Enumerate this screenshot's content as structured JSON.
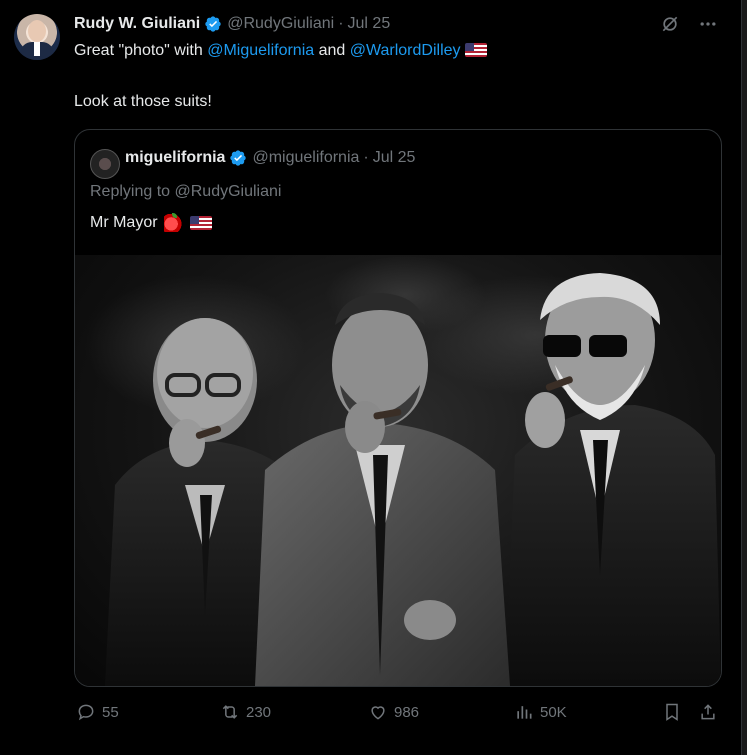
{
  "tweet": {
    "author_name": "Rudy W. Giuliani",
    "author_handle": "@RudyGiuliani",
    "date": "Jul 25",
    "line1_prefix": "Great \"photo\" with ",
    "mention1": "@Miguelifornia",
    "line1_mid": " and ",
    "mention2": "@WarlordDilley",
    "line2": "Look at those suits!"
  },
  "quoted": {
    "author_name": "miguelifornia",
    "author_handle": "@miguelifornia",
    "date": "Jul 25",
    "replying_to": "Replying to @RudyGiuliani",
    "text": "Mr Mayor"
  },
  "actions": {
    "replies": "55",
    "retweets": "230",
    "likes": "986",
    "views": "50K"
  },
  "icons": {
    "verified": "verified-badge-icon",
    "grok": "grok-icon",
    "more": "more-icon",
    "reply": "reply-icon",
    "retweet": "retweet-icon",
    "like": "heart-icon",
    "views": "views-chart-icon",
    "bookmark": "bookmark-icon",
    "share": "share-icon"
  },
  "colors": {
    "background": "#000000",
    "text": "#e7e9ea",
    "muted": "#71767b",
    "link": "#1d9bf0",
    "verified": "#1d9bf0"
  }
}
